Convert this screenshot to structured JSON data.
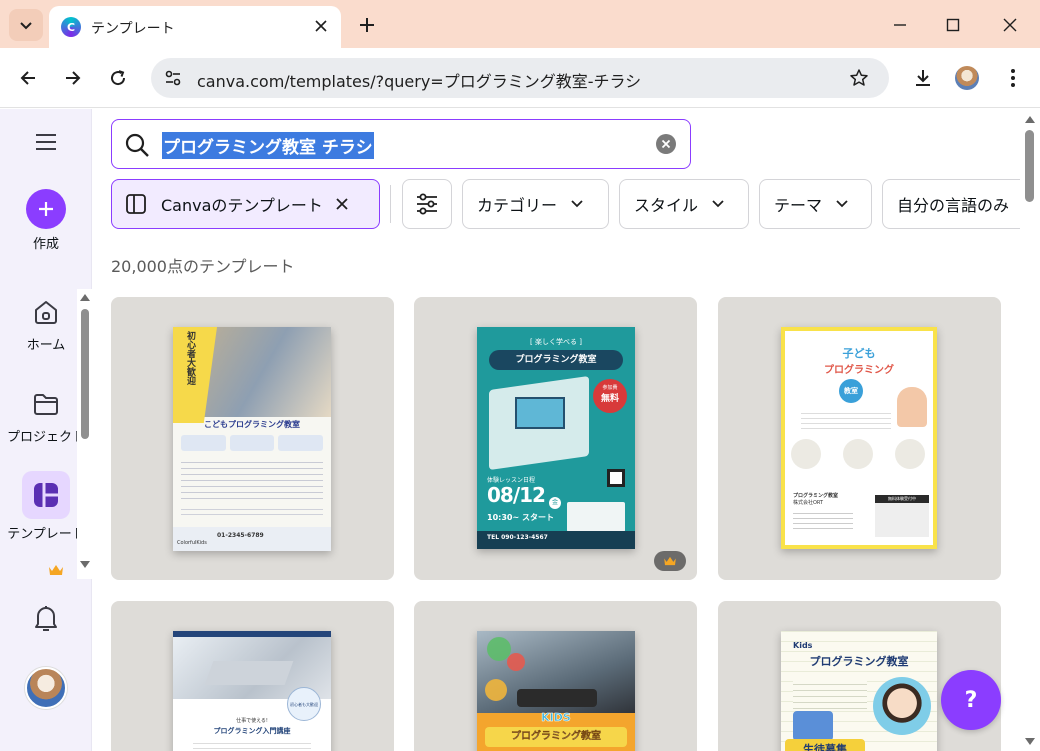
{
  "browser": {
    "tab_title": "テンプレート",
    "url": "canva.com/templates/?query=プログラミング教室-チラシ"
  },
  "rail": {
    "create_label": "作成",
    "home_label": "ホーム",
    "projects_label": "プロジェクト",
    "templates_label": "テンプレート"
  },
  "search": {
    "value": "プログラミング教室 チラシ"
  },
  "filters": {
    "canva_templates": "Canvaのテンプレート",
    "category": "カテゴリー",
    "style": "スタイル",
    "theme": "テーマ",
    "own_language": "自分の言語のみ"
  },
  "results": {
    "count_text": "20,000点のテンプレート"
  },
  "templates": [
    {
      "lines": [
        "初心者大歓迎",
        "こどもプログラミング教室",
        "01-2345-6789",
        "ColorfulKids"
      ]
    },
    {
      "lines": [
        "[ 楽しく学べる ]",
        "プログラミング教室",
        "参加費",
        "無料",
        "体験レッスン日程",
        "08/12",
        "金",
        "10:30~ スタート",
        "TEL 090-123-4567"
      ]
    },
    {
      "lines": [
        "子ども",
        "プログラミング",
        "教室",
        "プログラミング教室",
        "株式会社ORT",
        "無料体験受付中"
      ]
    },
    {
      "lines": [
        "仕事で使える!",
        "プログラミング入門講座",
        "初心者も大歓迎"
      ]
    },
    {
      "lines": [
        "KIDS",
        "プログラミング教室"
      ]
    },
    {
      "lines": [
        "Kids",
        "プログラミング教室",
        "生徒募集"
      ]
    }
  ],
  "help": {
    "label": "?"
  },
  "colors": {
    "accent": "#8b3dff",
    "tabbar": "#fadccd",
    "rail_bg": "#f3f1fb",
    "card_bg": "#dedcd8"
  },
  "icons": [
    "tab-search-icon",
    "close-icon",
    "plus-icon",
    "back-arrow-icon",
    "forward-arrow-icon",
    "reload-icon",
    "site-settings-icon",
    "star-icon",
    "download-icon",
    "kebab-menu-icon",
    "hamburger-icon",
    "home-icon",
    "folder-icon",
    "templates-icon",
    "crown-icon",
    "bell-icon",
    "search-icon",
    "clear-icon",
    "sliders-icon",
    "chevron-down-icon"
  ]
}
